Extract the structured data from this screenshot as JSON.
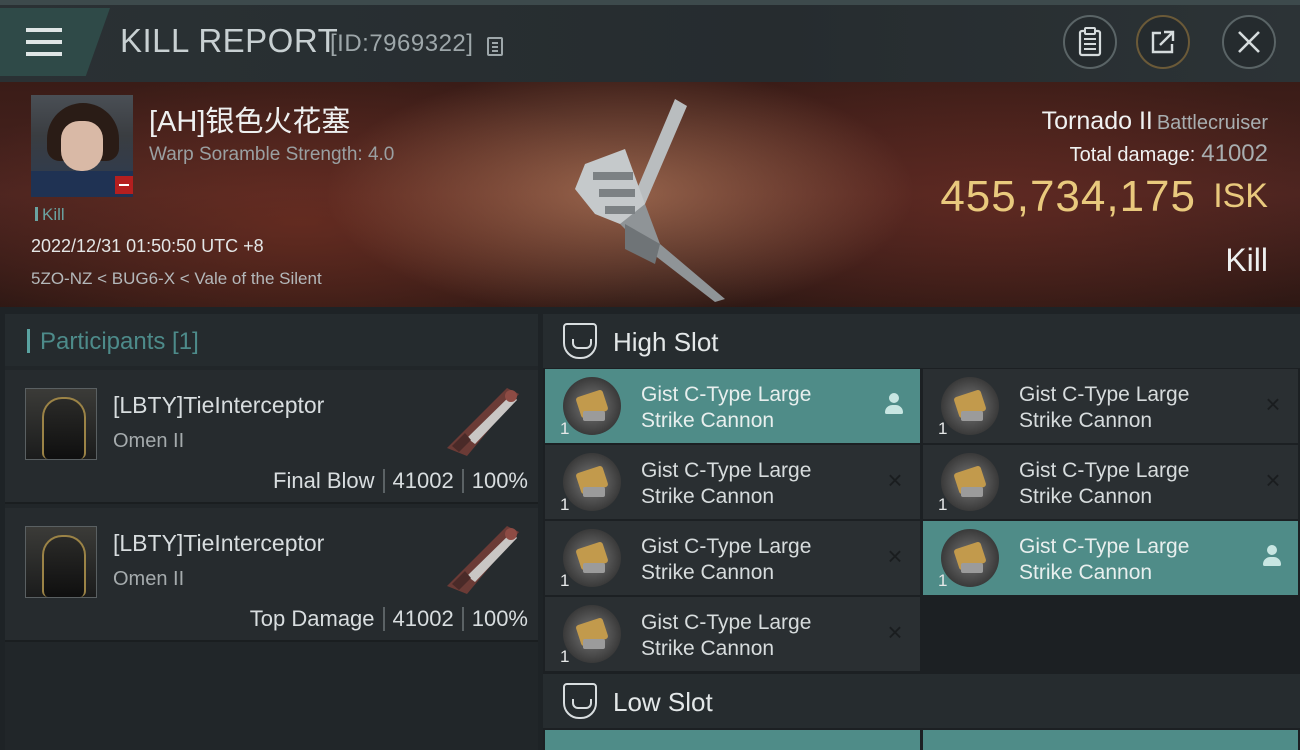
{
  "header": {
    "title": "KILL REPORT",
    "report_id": "[ID:7969322]"
  },
  "victim": {
    "pilot_name": "[AH]银色火花塞",
    "scramble_strength": "Warp Soramble Strength: 4.0",
    "tag": "Kill",
    "datetime": "2022/12/31 01:50:50 UTC +8",
    "location": "5ZO-NZ < BUG6-X < Vale of the Silent",
    "ship_name": "Tornado II",
    "ship_class": "Battlecruiser",
    "total_damage_label": "Total damage:",
    "total_damage": "41002",
    "isk_value": "455,734,175",
    "isk_unit": "ISK",
    "result": "Kill"
  },
  "participants": {
    "title": "Participants [1]",
    "rows": [
      {
        "name": "[LBTY]TieInterceptor",
        "ship": "Omen II",
        "role": "Final Blow",
        "damage": "41002",
        "percent": "100%"
      },
      {
        "name": "[LBTY]TieInterceptor",
        "ship": "Omen II",
        "role": "Top Damage",
        "damage": "41002",
        "percent": "100%"
      }
    ]
  },
  "slots": {
    "high_title": "High Slot",
    "low_title": "Low Slot",
    "high_modules": [
      {
        "name_line1": "Gist C-Type Large",
        "name_line2": "Strike Cannon",
        "qty": "1",
        "state": "dropped"
      },
      {
        "name_line1": "Gist C-Type Large",
        "name_line2": "Strike Cannon",
        "qty": "1",
        "state": "destroyed"
      },
      {
        "name_line1": "Gist C-Type Large",
        "name_line2": "Strike Cannon",
        "qty": "1",
        "state": "destroyed"
      },
      {
        "name_line1": "Gist C-Type Large",
        "name_line2": "Strike Cannon",
        "qty": "1",
        "state": "destroyed"
      },
      {
        "name_line1": "Gist C-Type Large",
        "name_line2": "Strike Cannon",
        "qty": "1",
        "state": "destroyed"
      },
      {
        "name_line1": "Gist C-Type Large",
        "name_line2": "Strike Cannon",
        "qty": "1",
        "state": "dropped"
      },
      {
        "name_line1": "Gist C-Type Large",
        "name_line2": "Strike Cannon",
        "qty": "1",
        "state": "destroyed"
      }
    ]
  },
  "icons": {
    "menu": "menu-icon",
    "copy": "copy-icon",
    "clipboard": "clipboard-icon",
    "share": "share-icon",
    "close": "close-icon",
    "destroyed": "x-mark-icon",
    "dropped": "person-icon"
  },
  "colors": {
    "accent_teal": "#4f8c88",
    "isk_gold": "#e9c97d",
    "badge_red": "#b41f1f"
  }
}
